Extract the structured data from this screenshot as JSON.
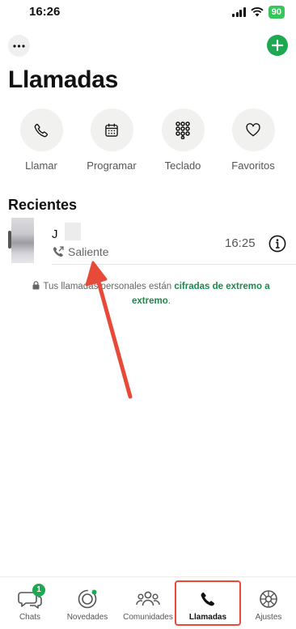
{
  "status_bar": {
    "time": "16:26",
    "battery": "90"
  },
  "header": {
    "title": "Llamadas"
  },
  "actions": [
    {
      "label": "Llamar",
      "icon": "phone-icon"
    },
    {
      "label": "Programar",
      "icon": "calendar-icon"
    },
    {
      "label": "Teclado",
      "icon": "keypad-icon"
    },
    {
      "label": "Favoritos",
      "icon": "heart-icon"
    }
  ],
  "recents": {
    "title": "Recientes",
    "calls": [
      {
        "name": "J",
        "type": "Saliente",
        "time": "16:25"
      }
    ]
  },
  "encryption_note": {
    "text": "Tus llamadas personales están ",
    "link": "cifradas de extremo a extremo",
    "suffix": "."
  },
  "tabbar": {
    "tabs": [
      {
        "label": "Chats",
        "badge": "1",
        "icon": "chats-icon"
      },
      {
        "label": "Novedades",
        "icon": "updates-icon"
      },
      {
        "label": "Comunidades",
        "icon": "communities-icon"
      },
      {
        "label": "Llamadas",
        "icon": "calls-icon",
        "active": true
      },
      {
        "label": "Ajustes",
        "icon": "settings-icon"
      }
    ]
  },
  "colors": {
    "accent": "#1da851",
    "annotation": "#e84a3a"
  }
}
